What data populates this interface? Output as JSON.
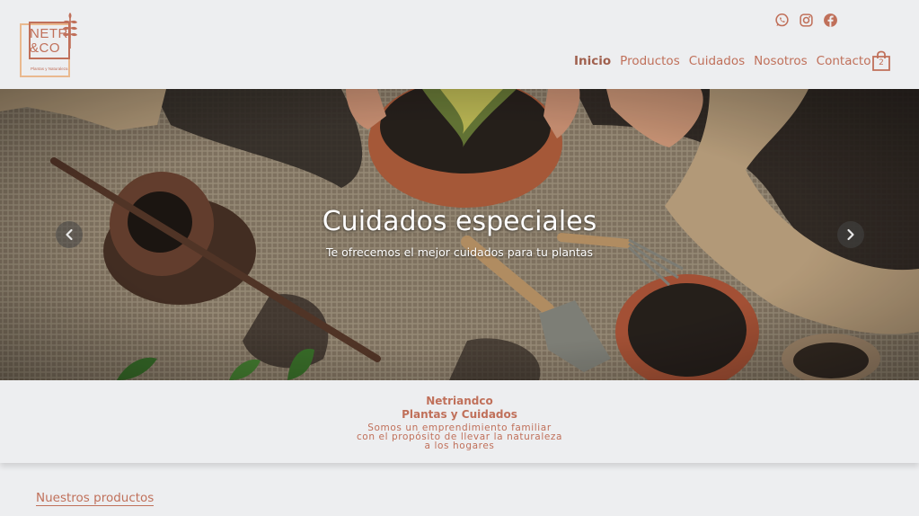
{
  "brand": {
    "logo_line1": "NETRI",
    "logo_line2": "&CO",
    "logo_sub": "Plantas y Naturaleza"
  },
  "social": [
    {
      "icon": "whatsapp-icon"
    },
    {
      "icon": "instagram-icon"
    },
    {
      "icon": "facebook-icon"
    }
  ],
  "nav": {
    "items": [
      "Inicio",
      "Productos",
      "Cuidados",
      "Nosotros",
      "Contacto"
    ],
    "active": "Inicio"
  },
  "cart": {
    "count": "2",
    "icon": "shopping-bag-icon"
  },
  "hero": {
    "title": "Cuidados especiales",
    "subtitle": "Te ofrecemos el mejor cuidados para tu plantas",
    "prev_icon": "chevron-left-icon",
    "next_icon": "chevron-right-icon"
  },
  "intro": {
    "brand": "Netriandco",
    "tagline": "Plantas y Cuidados",
    "desc_lines": [
      "Somos un emprendimiento familiar",
      "con el propósito de llevar la naturaleza",
      "a los hogares"
    ]
  },
  "products_link": "Nuestros productos",
  "colors": {
    "accent": "#c0705a",
    "accent_light": "#e9b98f",
    "background": "#edeef0"
  }
}
